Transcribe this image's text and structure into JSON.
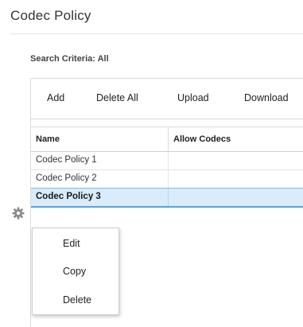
{
  "page": {
    "title": "Codec Policy"
  },
  "search": {
    "criteria_label": "Search Criteria: All"
  },
  "toolbar": {
    "add_label": "Add",
    "delete_all_label": "Delete All",
    "upload_label": "Upload",
    "download_label": "Download"
  },
  "table": {
    "columns": [
      "Name",
      "Allow Codecs"
    ],
    "rows": [
      {
        "name": "Codec Policy 1",
        "allow_codecs": ""
      },
      {
        "name": "Codec Policy 2",
        "allow_codecs": ""
      },
      {
        "name": "Codec Policy 3",
        "allow_codecs": "",
        "selected": true
      }
    ]
  },
  "context_menu": {
    "items": [
      "Edit",
      "Copy",
      "Delete"
    ]
  },
  "icons": {
    "row_actions": "gear-icon"
  },
  "colors": {
    "selected_row_bg": "#d8ecfb",
    "selected_row_border": "#5aa3dc",
    "gear_icon": "#8a8a8a"
  }
}
